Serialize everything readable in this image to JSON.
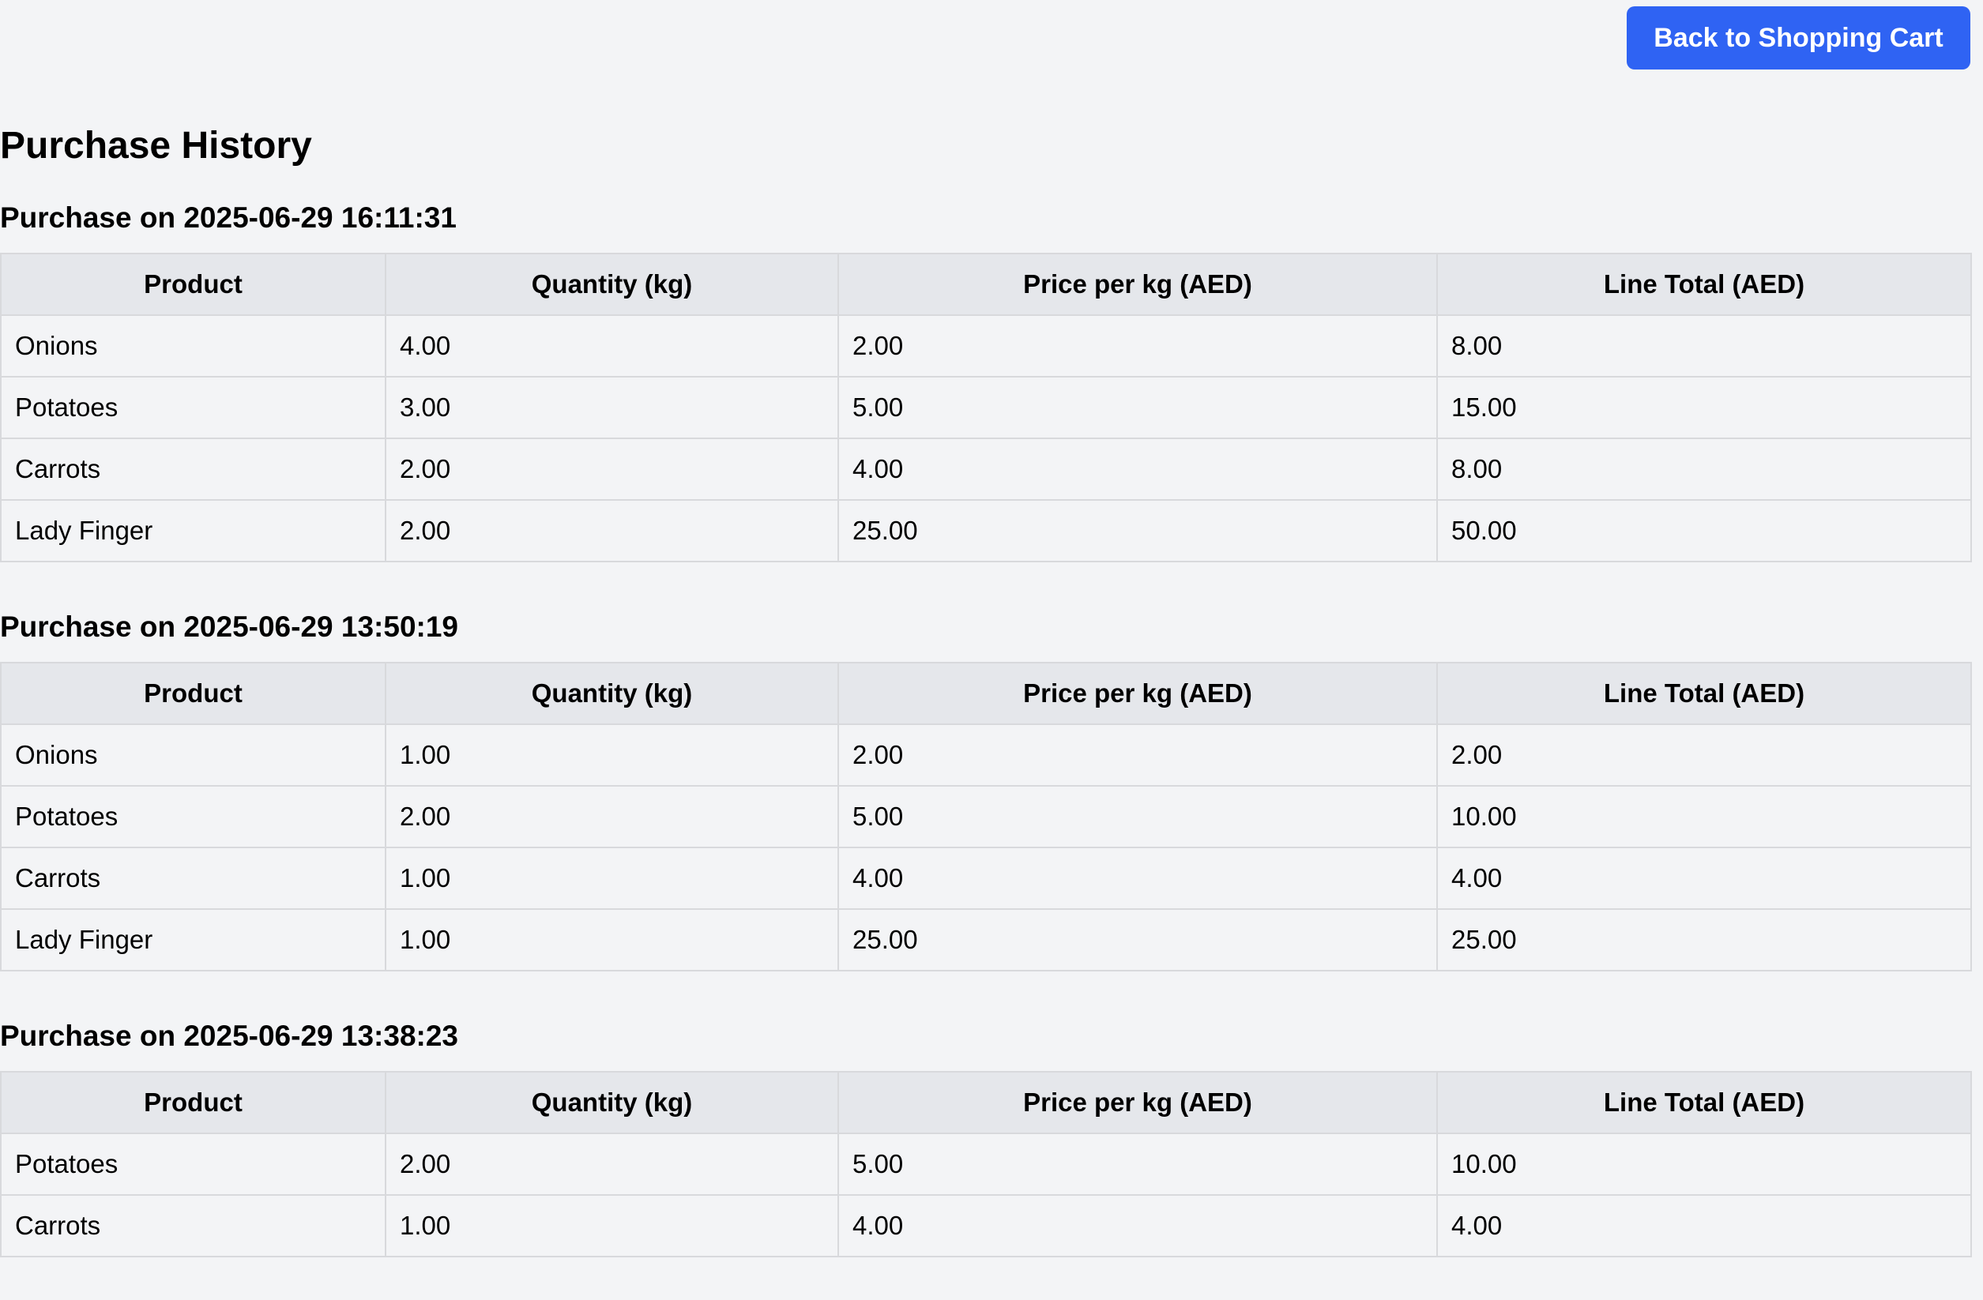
{
  "header": {
    "back_button_label": "Back to Shopping Cart"
  },
  "page": {
    "title": "Purchase History"
  },
  "table_headers": [
    "Product",
    "Quantity (kg)",
    "Price per kg (AED)",
    "Line Total (AED)"
  ],
  "purchases": [
    {
      "heading": "Purchase on 2025-06-29 16:11:31",
      "rows": [
        [
          "Onions",
          "4.00",
          "2.00",
          "8.00"
        ],
        [
          "Potatoes",
          "3.00",
          "5.00",
          "15.00"
        ],
        [
          "Carrots",
          "2.00",
          "4.00",
          "8.00"
        ],
        [
          "Lady Finger",
          "2.00",
          "25.00",
          "50.00"
        ]
      ]
    },
    {
      "heading": "Purchase on 2025-06-29 13:50:19",
      "rows": [
        [
          "Onions",
          "1.00",
          "2.00",
          "2.00"
        ],
        [
          "Potatoes",
          "2.00",
          "5.00",
          "10.00"
        ],
        [
          "Carrots",
          "1.00",
          "4.00",
          "4.00"
        ],
        [
          "Lady Finger",
          "1.00",
          "25.00",
          "25.00"
        ]
      ]
    },
    {
      "heading": "Purchase on 2025-06-29 13:38:23",
      "rows": [
        [
          "Potatoes",
          "2.00",
          "5.00",
          "10.00"
        ],
        [
          "Carrots",
          "1.00",
          "4.00",
          "4.00"
        ]
      ]
    }
  ]
}
